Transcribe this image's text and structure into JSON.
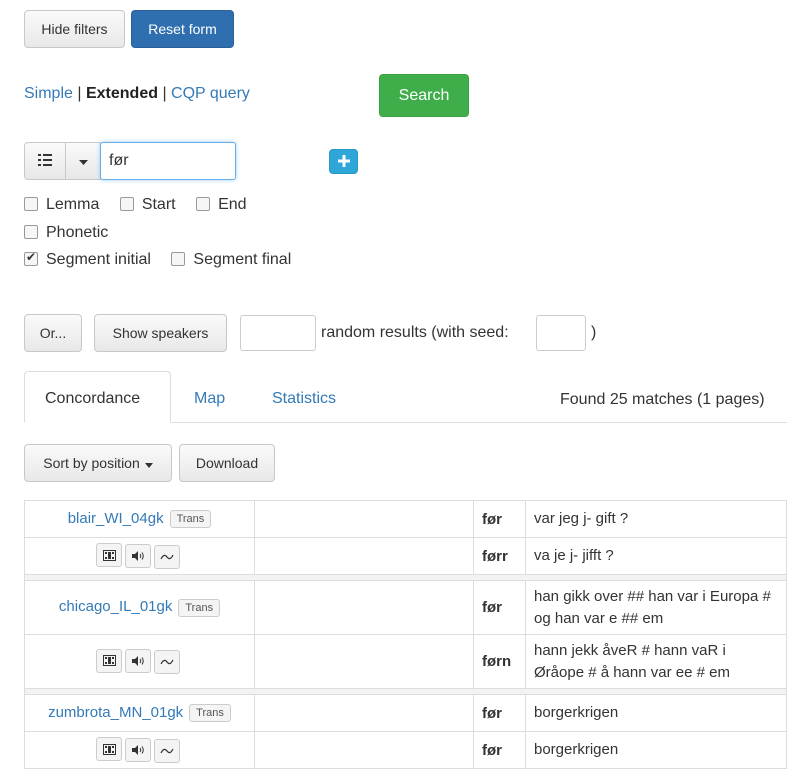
{
  "filters": {
    "hide_label": "Hide filters",
    "reset_label": "Reset form"
  },
  "mode": {
    "simple": "Simple",
    "sep1": "|",
    "extended": "Extended",
    "sep2": "|",
    "cqp": "CQP query"
  },
  "search_label": "Search",
  "token": {
    "value": "før"
  },
  "checkboxes": {
    "lemma": "Lemma",
    "start": "Start",
    "end": "End",
    "phonetic": "Phonetic",
    "segment_initial": "Segment initial",
    "segment_final": "Segment final"
  },
  "options": {
    "or_label": "Or...",
    "show_speakers_label": "Show speakers",
    "random_text": "random results (with seed:",
    "close_paren": ")"
  },
  "tabs": {
    "concordance": "Concordance",
    "map": "Map",
    "statistics": "Statistics"
  },
  "matches_text": "Found 25 matches (1 pages)",
  "sort_label": "Sort by position",
  "download_label": "Download",
  "colors": {
    "primary": "#2f6fb0",
    "success": "#3fae4a",
    "link": "#337ab7",
    "info": "#2ea6d8"
  },
  "results": [
    {
      "speaker": "blair_WI_04gk",
      "trans": "Trans",
      "lines": [
        {
          "word": "før",
          "right": "var jeg j- gift ?"
        },
        {
          "word": "førr",
          "right": "va je j- jifft ?"
        }
      ]
    },
    {
      "speaker": "chicago_IL_01gk",
      "trans": "Trans",
      "lines": [
        {
          "word": "før",
          "right": "han gikk over ## han var i Europa # og han var e ## em"
        },
        {
          "word": "førn",
          "right": "hann jekk åveR # hann vaR i Øråope # å hann var ee # em"
        }
      ]
    },
    {
      "speaker": "zumbrota_MN_01gk",
      "trans": "Trans",
      "lines": [
        {
          "word": "før",
          "right": "borgerkrigen"
        },
        {
          "word": "før",
          "right": "borgerkrigen"
        }
      ]
    }
  ]
}
